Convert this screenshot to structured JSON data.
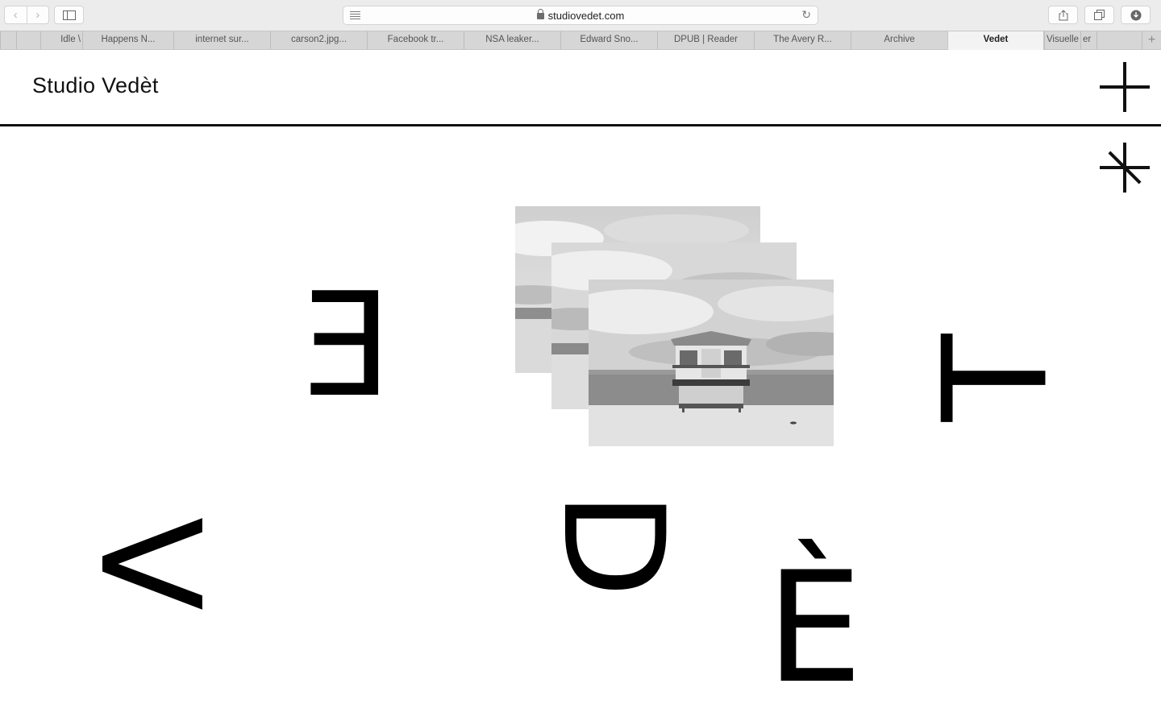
{
  "browser": {
    "url": "studiovedet.com",
    "nav": {
      "back_icon": "‹",
      "forward_icon": "›"
    },
    "tabs": [
      {
        "label": "Idle \\"
      },
      {
        "label": "Happens N..."
      },
      {
        "label": "internet sur..."
      },
      {
        "label": "carson2.jpg..."
      },
      {
        "label": "Facebook tr..."
      },
      {
        "label": "NSA leaker..."
      },
      {
        "label": "Edward Sno..."
      },
      {
        "label": "DPUB | Reader"
      },
      {
        "label": "The Avery R..."
      },
      {
        "label": "Archive"
      },
      {
        "label": "Vedet"
      },
      {
        "label": "Visuelle"
      },
      {
        "label": "er"
      }
    ],
    "new_tab": "+"
  },
  "site": {
    "title": "Studio Vedèt",
    "letters": {
      "e_mirrored": "E",
      "t_rotated": "T",
      "v_rotated": "V",
      "d_rotated": "D",
      "e_grave": "È"
    }
  }
}
